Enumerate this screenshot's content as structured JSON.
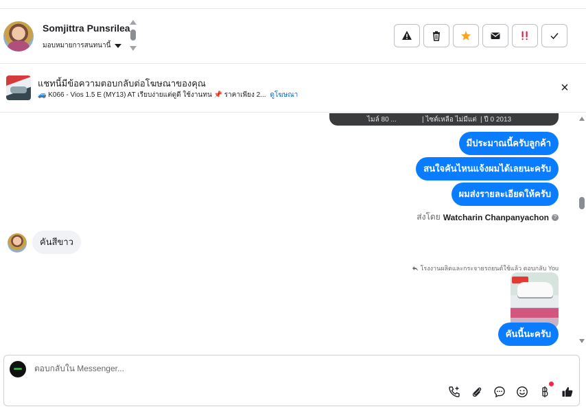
{
  "header": {
    "contact_name": "Somjittra Punsrilea",
    "assign_label": "มอบหมายการสนทนานี้",
    "actions": [
      {
        "name": "spam-button",
        "icon": "warning-icon"
      },
      {
        "name": "delete-button",
        "icon": "trash-icon"
      },
      {
        "name": "star-button",
        "icon": "star-icon"
      },
      {
        "name": "mark-unread-button",
        "icon": "envelope-icon"
      },
      {
        "name": "priority-button",
        "icon": "priority-icon"
      },
      {
        "name": "done-button",
        "icon": "check-icon"
      }
    ]
  },
  "ad_banner": {
    "title": "แชทนี้มีข้อความตอบกลับต่อโฆษณาของคุณ",
    "subtitle": "🚙 K066 - Vios 1.5 E (MY13) AT เรียบง่ายแต่ดูดี ใช้งานทน 📌 ราคาเพียง 2...",
    "link": "ดูโฆษณา"
  },
  "messages": {
    "prev_card": [
      "ไมล์ 80 ... ",
      "| ไซต์เหลือ ไม่มีแต่",
      "| ปี 0 2013"
    ],
    "outgoing": [
      "มีประมาณนี้ครับลูกค้า",
      "สนใจคันไหนแจ้งผมได้เลยนะครับ",
      "ผมส่งรายละเอียดให้ครับ"
    ],
    "sent_by_prefix": "ส่งโดย",
    "sent_by_name": "Watcharin Chanpanyachon",
    "incoming": "คันสีขาว",
    "replied_note": "โรงงานผลิตและกระจายรถยนต์ใช้แล้ว ตอบกลับ You",
    "last_outgoing": "คันนี้นะครับ"
  },
  "composer": {
    "placeholder": "ตอบกลับใน Messenger...",
    "tools": [
      "phone-add-icon",
      "paperclip-icon",
      "chat-bubble-icon",
      "smiley-icon",
      "baht-icon",
      "thumbs-up-icon"
    ]
  },
  "colors": {
    "accent": "#0a7cff",
    "star": "#f5a623",
    "priority": "#e41e3f",
    "link": "#0a66c2"
  }
}
